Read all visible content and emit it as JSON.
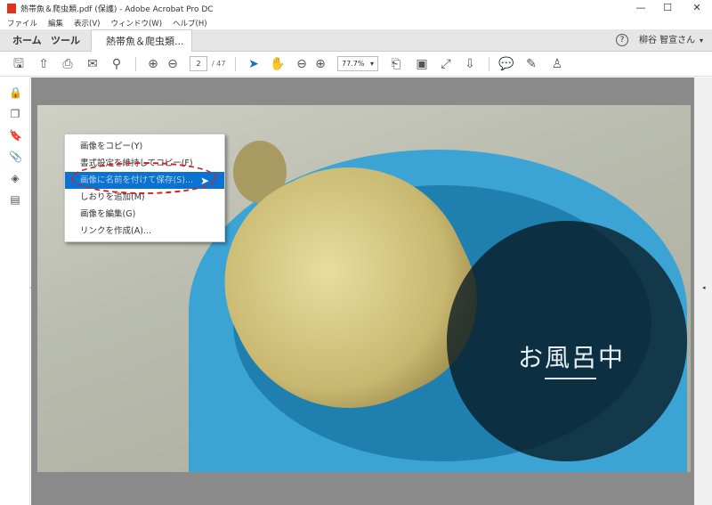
{
  "window": {
    "title": "熱帯魚＆爬虫類.pdf (保護) - Adobe Acrobat Pro DC",
    "minimize": "—",
    "maximize": "☐",
    "close": "✕"
  },
  "menu": [
    "ファイル",
    "編集",
    "表示(V)",
    "ウィンドウ(W)",
    "ヘルプ(H)"
  ],
  "tabs": {
    "home": "ホーム",
    "tools": "ツール",
    "document": "熱帯魚＆爬虫類...",
    "close": "×"
  },
  "user": {
    "help": "?",
    "name": "柳谷 智宣さん",
    "caret": "▾"
  },
  "toolbar": {
    "page_current": "2",
    "page_total": "/ 47",
    "zoom": "77.7%",
    "zoom_caret": "▾"
  },
  "page": {
    "caption": "お風呂中"
  },
  "context_menu": [
    "画像をコピー(Y)",
    "書式設定を維持してコピー(F)",
    "画像に名前を付けて保存(S)...",
    "しおりを追加(M)",
    "画像を編集(G)",
    "リンクを作成(A)..."
  ]
}
